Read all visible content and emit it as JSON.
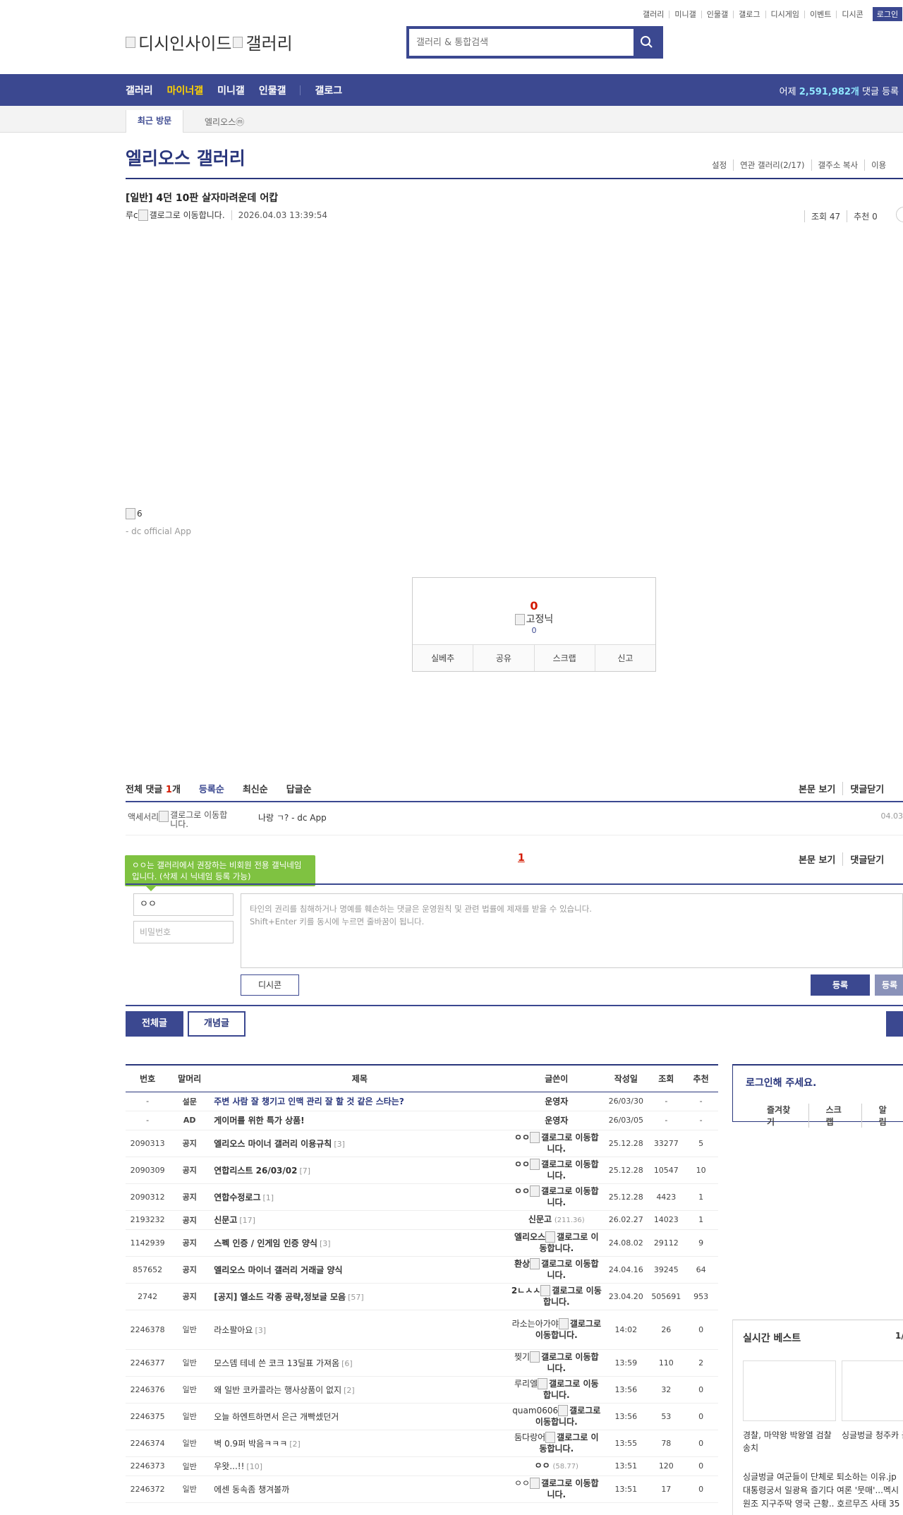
{
  "util_nav": [
    "갤러리",
    "미니갤",
    "인물갤",
    "갤로그",
    "디시게임",
    "이벤트",
    "디시콘"
  ],
  "util_login": "로그인",
  "logo": {
    "left_alt": "디시인사이드",
    "right_alt": "갤러리"
  },
  "search": {
    "placeholder": "갤러리 & 통합검색"
  },
  "gnb": {
    "items": [
      "갤러리",
      "마이너갤",
      "미니갤",
      "인물갤",
      "갤로그"
    ],
    "active": "마이너갤",
    "stat_prefix": "어제 ",
    "stat_count": "2,591,982개",
    "stat_suffix": " 댓글 등록"
  },
  "visit": {
    "label": "최근 방문",
    "item": "엘리오스ⓜ"
  },
  "gallery": {
    "title": "엘리오스 갤러리",
    "menu": [
      "설정",
      "연관 갤러리(2/17)",
      "갤주소 복사",
      "이용"
    ]
  },
  "post": {
    "title": "[일반] 4던 10판 살자마려운데 어캅",
    "author": "루c",
    "author_badge": "갤로그로 이동합니다.",
    "date": "2026.04.03 13:39:54",
    "views": "조회 47",
    "recommend": "추천 0",
    "body_img": "6",
    "app_sig": "- dc official App"
  },
  "vote": {
    "count": "0",
    "nick": "고정닉",
    "sub": "0",
    "buttons": [
      "실베추",
      "공유",
      "스크랩",
      "신고"
    ]
  },
  "comments": {
    "all_prefix": "전체 댓글 ",
    "all_count": "1",
    "all_suffix": "개",
    "sorts": [
      "등록순",
      "최신순",
      "답글순"
    ],
    "right": [
      "본문 보기",
      "댓글닫기"
    ],
    "items": [
      {
        "author": "액세서리",
        "badge": "갤로그로 이동합니다.",
        "text": "나랑 ㄱ? - dc App",
        "date": "04.03"
      }
    ],
    "page": "1",
    "tip": "ㅇㅇ는 갤러리에서 권장하는 비회원 전용 갤닉네임입니다. (삭제 시 닉네임 등록 가능)",
    "name_value": "ㅇㅇ",
    "pw_placeholder": "비밀번호",
    "textarea_line1": "타인의 권리를 침해하거나 명예를 훼손하는 댓글은 운영원칙 및 관련 법률에 제재를 받을 수 있습니다.",
    "textarea_line2": "Shift+Enter 키를 동시에 누르면 줄바꿈이 됩니다.",
    "dccon": "디시콘",
    "submit": "등록",
    "submit2": "등록"
  },
  "list_tabs": {
    "all": "전체글",
    "concept": "개념글"
  },
  "table": {
    "headers": [
      "번호",
      "말머리",
      "제목",
      "글쓴이",
      "작성일",
      "조회",
      "추천"
    ],
    "rows": [
      {
        "no": "-",
        "head": "설문",
        "title": "주변 사람 잘 챙기고 인맥 관리 잘 할 것 같은 스타는?",
        "rc": "",
        "writer": "운영자",
        "badge": "",
        "ip": "",
        "date": "26/03/30",
        "view": "-",
        "rec": "-",
        "style": "blue"
      },
      {
        "no": "-",
        "head": "AD",
        "title": "게이머를 위한 특가 상품!",
        "rc": "",
        "writer": "운영자",
        "badge": "",
        "ip": "",
        "date": "26/03/05",
        "view": "-",
        "rec": "-",
        "style": "bold"
      },
      {
        "no": "2090313",
        "head": "공지",
        "title": "엘리오스 마이너 갤러리 이용규칙",
        "rc": "[3]",
        "writer": "ㅇㅇ",
        "badge": "갤로그로 이동합니다.",
        "ip": "",
        "date": "25.12.28",
        "view": "33277",
        "rec": "5",
        "style": "bold"
      },
      {
        "no": "2090309",
        "head": "공지",
        "title": "연합리스트 26/03/02",
        "rc": "[7]",
        "writer": "ㅇㅇ",
        "badge": "갤로그로 이동합니다.",
        "ip": "",
        "date": "25.12.28",
        "view": "10547",
        "rec": "10",
        "style": "bold"
      },
      {
        "no": "2090312",
        "head": "공지",
        "title": "연합수정로그",
        "rc": "[1]",
        "writer": "ㅇㅇ",
        "badge": "갤로그로 이동합니다.",
        "ip": "",
        "date": "25.12.28",
        "view": "4423",
        "rec": "1",
        "style": "bold"
      },
      {
        "no": "2193232",
        "head": "공지",
        "title": "신문고",
        "rc": "[17]",
        "writer": "신문고",
        "badge": "",
        "ip": "(211.36)",
        "date": "26.02.27",
        "view": "14023",
        "rec": "1",
        "style": "bold"
      },
      {
        "no": "1142939",
        "head": "공지",
        "title": "스펙 인증 / 인게임 인증 양식",
        "rc": "[3]",
        "writer": "엘리오스",
        "badge": "갤로그로 이동합니다.",
        "ip": "",
        "date": "24.08.02",
        "view": "29112",
        "rec": "9",
        "style": "bold"
      },
      {
        "no": "857652",
        "head": "공지",
        "title": "엘리오스 마이너 갤러리 거래글 양식",
        "rc": "",
        "writer": "환상",
        "badge": "갤로그로 이동합니다.",
        "ip": "",
        "date": "24.04.16",
        "view": "39245",
        "rec": "64",
        "style": "bold"
      },
      {
        "no": "2742",
        "head": "공지",
        "title": "[공지] 엘소드 각종 공략,정보글 모음",
        "rc": "[57]",
        "writer": "2ㄴㅅㅅ",
        "badge": "갤로그로 이동합니다.",
        "ip": "",
        "date": "23.04.20",
        "view": "505691",
        "rec": "953",
        "style": "bold"
      },
      {
        "no": "2246378",
        "head": "일반",
        "title": "라소팔아요",
        "rc": "[3]",
        "writer": "라소는아가야",
        "badge": "갤로그로 이동합니다.",
        "ip": "",
        "date": "14:02",
        "view": "26",
        "rec": "0",
        "style": "normal"
      },
      {
        "no": "2246377",
        "head": "일반",
        "title": "모스뎀 테네 쓴 코크 13딜표 가져옴",
        "rc": "[6]",
        "writer": "찢기",
        "badge": "갤로그로 이동합니다.",
        "ip": "",
        "date": "13:59",
        "view": "110",
        "rec": "2",
        "style": "normal"
      },
      {
        "no": "2246376",
        "head": "일반",
        "title": "왜 일반 코카콜라는 행사상품이 없지",
        "rc": "[2]",
        "writer": "루리엘",
        "badge": "갤로그로 이동합니다.",
        "ip": "",
        "date": "13:56",
        "view": "32",
        "rec": "0",
        "style": "normal"
      },
      {
        "no": "2246375",
        "head": "일반",
        "title": "오늘 하엔트하면서 은근 개빡셌던거",
        "rc": "",
        "writer": "quam0606",
        "badge": "갤로그로 이동합니다.",
        "ip": "",
        "date": "13:56",
        "view": "53",
        "rec": "0",
        "style": "normal"
      },
      {
        "no": "2246374",
        "head": "일반",
        "title": "벽 0.9퍼 박음ㅋㅋㅋ",
        "rc": "[2]",
        "writer": "둠다랑어",
        "badge": "갤로그로 이동합니다.",
        "ip": "",
        "date": "13:55",
        "view": "78",
        "rec": "0",
        "style": "normal"
      },
      {
        "no": "2246373",
        "head": "일반",
        "title": "우왓...!!",
        "rc": "[10]",
        "writer": "ㅇㅇ",
        "badge": "",
        "ip": "(58.77)",
        "date": "13:51",
        "view": "120",
        "rec": "0",
        "style": "normal"
      },
      {
        "no": "2246372",
        "head": "일반",
        "title": "에센 동속좀 챙겨볼까",
        "rc": "",
        "writer": "ㅇㅇ",
        "badge": "갤로그로 이동합니다.",
        "ip": "",
        "date": "13:51",
        "view": "17",
        "rec": "0",
        "style": "normal"
      }
    ]
  },
  "sidebar": {
    "login_title": "로그인해 주세요.",
    "login_links": [
      "즐겨찾기",
      "스크랩",
      "알림"
    ],
    "best_title": "실시간 베스트",
    "best_page": "1/",
    "best_cap1": "경찰, 마약왕 박왕열 검찰 송치",
    "best_cap2": "싱글벙글 청주카 근황",
    "best_rows": [
      "싱글벙글 여군들이 단체로 퇴소하는 이유.jp",
      "대통령궁서 일광욕 즐기다 여론 '뭇매'...멕시",
      "원조 지구주딱 영국 근황.. 호르무즈 사태 35"
    ]
  }
}
